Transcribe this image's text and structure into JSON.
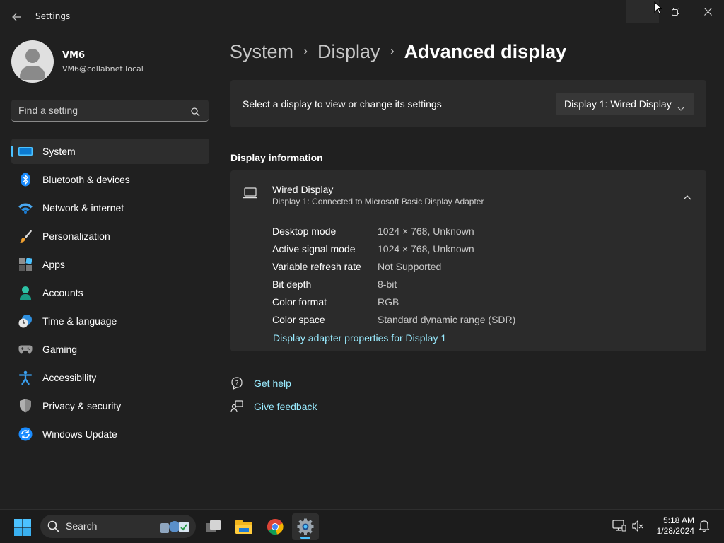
{
  "window": {
    "title": "Settings",
    "back_icon": "back-arrow-icon",
    "controls": [
      "minimize-icon",
      "maximize-icon",
      "close-icon"
    ]
  },
  "user": {
    "name": "VM6",
    "email": "VM6@collabnet.local"
  },
  "search": {
    "placeholder": "Find a setting"
  },
  "nav": {
    "items": [
      {
        "label": "System",
        "icon": "system-icon",
        "active": true
      },
      {
        "label": "Bluetooth & devices",
        "icon": "bluetooth-icon"
      },
      {
        "label": "Network & internet",
        "icon": "wifi-icon"
      },
      {
        "label": "Personalization",
        "icon": "paintbrush-icon"
      },
      {
        "label": "Apps",
        "icon": "apps-icon"
      },
      {
        "label": "Accounts",
        "icon": "accounts-icon"
      },
      {
        "label": "Time & language",
        "icon": "clock-globe-icon"
      },
      {
        "label": "Gaming",
        "icon": "gamepad-icon"
      },
      {
        "label": "Accessibility",
        "icon": "accessibility-icon"
      },
      {
        "label": "Privacy & security",
        "icon": "shield-icon"
      },
      {
        "label": "Windows Update",
        "icon": "update-icon"
      }
    ]
  },
  "breadcrumb": {
    "items": [
      "System",
      "Display",
      "Advanced display"
    ]
  },
  "display_select": {
    "label": "Select a display to view or change its settings",
    "value": "Display 1: Wired Display"
  },
  "display_info": {
    "section_title": "Display information",
    "name": "Wired Display",
    "subtitle": "Display 1: Connected to Microsoft Basic Display Adapter",
    "rows": [
      {
        "key": "Desktop mode",
        "value": "1024 × 768, Unknown"
      },
      {
        "key": "Active signal mode",
        "value": "1024 × 768, Unknown"
      },
      {
        "key": "Variable refresh rate",
        "value": "Not Supported"
      },
      {
        "key": "Bit depth",
        "value": "8-bit"
      },
      {
        "key": "Color format",
        "value": "RGB"
      },
      {
        "key": "Color space",
        "value": "Standard dynamic range (SDR)"
      }
    ],
    "link": "Display adapter properties for Display 1"
  },
  "help": {
    "get_help": "Get help",
    "give_feedback": "Give feedback"
  },
  "colors": {
    "accent": "#4cc2ff",
    "link": "#99ebff",
    "background": "#202020",
    "card": "#2b2b2b"
  },
  "taskbar": {
    "search_label": "Search",
    "apps": [
      "task-view-icon",
      "file-explorer-icon",
      "chrome-icon",
      "settings-icon"
    ],
    "time": "5:18 AM",
    "date": "1/28/2024"
  }
}
